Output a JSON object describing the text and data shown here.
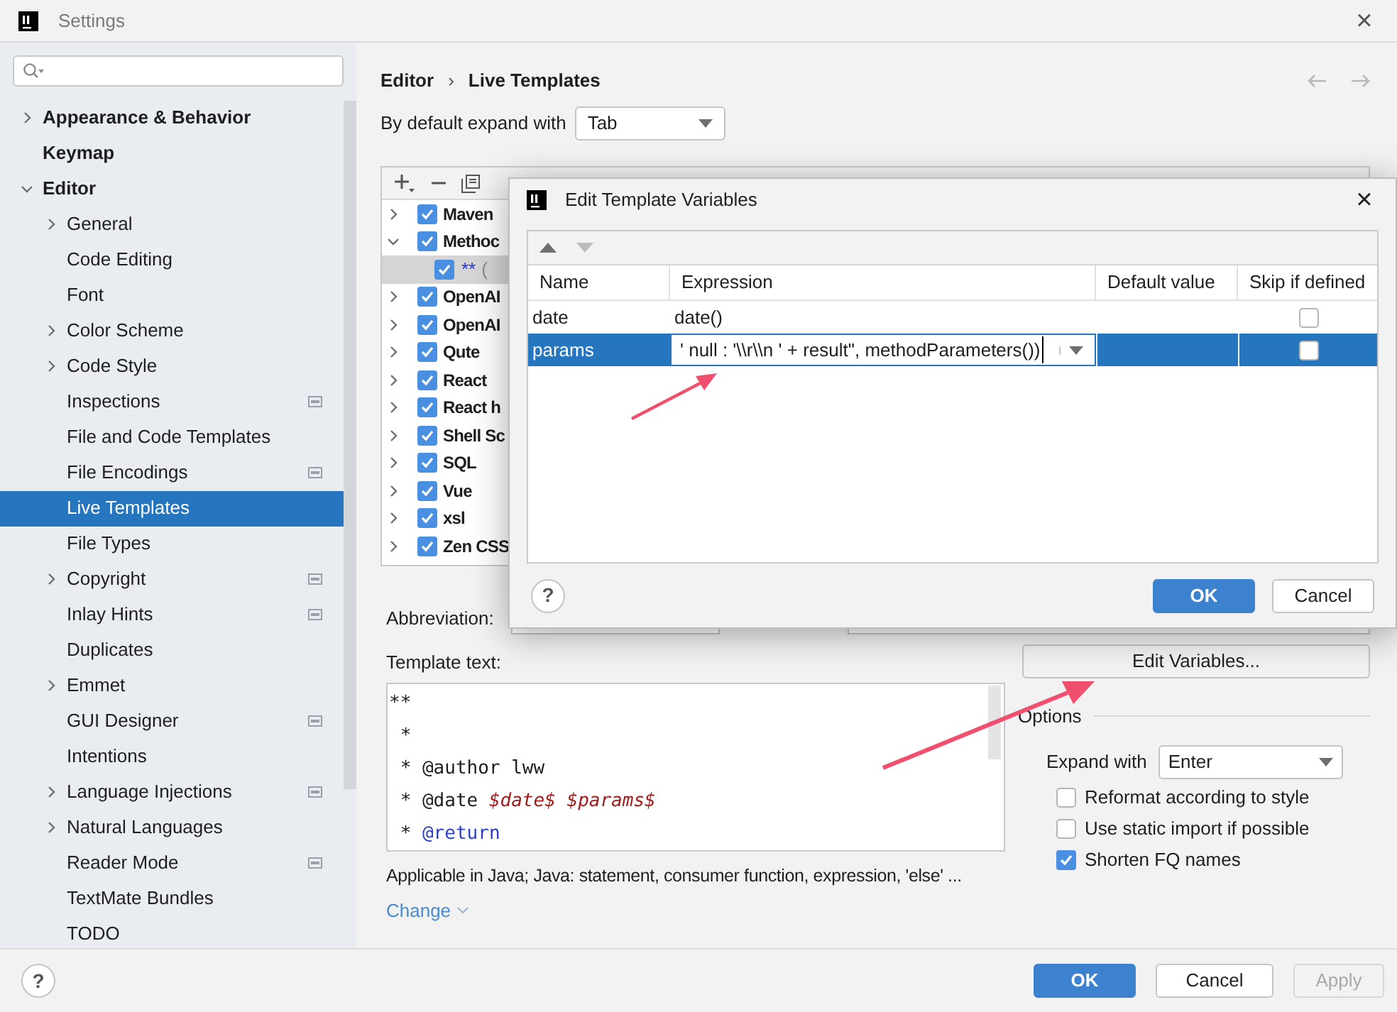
{
  "window": {
    "title": "Settings",
    "close": "×"
  },
  "sidebar": {
    "items": [
      {
        "label": "Appearance & Behavior",
        "expanded": false,
        "selected": false
      },
      {
        "label": "Keymap",
        "selected": false
      },
      {
        "label": "Editor",
        "expanded": true,
        "selected": false,
        "children": [
          {
            "label": "General",
            "expanded": false,
            "selected": false,
            "project_scoped": false
          },
          {
            "label": "Code Editing",
            "selected": false,
            "project_scoped": false
          },
          {
            "label": "Font",
            "selected": false,
            "project_scoped": false
          },
          {
            "label": "Color Scheme",
            "expanded": false,
            "selected": false,
            "project_scoped": false
          },
          {
            "label": "Code Style",
            "expanded": false,
            "selected": false,
            "project_scoped": false
          },
          {
            "label": "Inspections",
            "selected": false,
            "project_scoped": true
          },
          {
            "label": "File and Code Templates",
            "selected": false,
            "project_scoped": false
          },
          {
            "label": "File Encodings",
            "selected": false,
            "project_scoped": true
          },
          {
            "label": "Live Templates",
            "selected": true,
            "project_scoped": false
          },
          {
            "label": "File Types",
            "selected": false,
            "project_scoped": false
          },
          {
            "label": "Copyright",
            "expanded": false,
            "selected": false,
            "project_scoped": true
          },
          {
            "label": "Inlay Hints",
            "selected": false,
            "project_scoped": true
          },
          {
            "label": "Duplicates",
            "selected": false,
            "project_scoped": false
          },
          {
            "label": "Emmet",
            "expanded": false,
            "selected": false,
            "project_scoped": false
          },
          {
            "label": "GUI Designer",
            "selected": false,
            "project_scoped": true
          },
          {
            "label": "Intentions",
            "selected": false,
            "project_scoped": false
          },
          {
            "label": "Language Injections",
            "expanded": false,
            "selected": false,
            "project_scoped": true
          },
          {
            "label": "Natural Languages",
            "expanded": false,
            "selected": false,
            "project_scoped": false
          },
          {
            "label": "Reader Mode",
            "selected": false,
            "project_scoped": true
          },
          {
            "label": "TextMate Bundles",
            "selected": false,
            "project_scoped": false
          },
          {
            "label": "TODO",
            "selected": false,
            "project_scoped": false
          }
        ]
      }
    ]
  },
  "breadcrumb": [
    "Editor",
    "›",
    "Live Templates"
  ],
  "default_expand": {
    "label": "By default expand with",
    "value": "Tab"
  },
  "template_groups": [
    {
      "label": "Maven",
      "expanded": false,
      "checked": true
    },
    {
      "label": "Methoc",
      "expanded": true,
      "checked": true,
      "children": [
        {
          "abbreviation": "**",
          "description": "(",
          "checked": true,
          "selected": true
        }
      ]
    },
    {
      "label": "OpenAI",
      "expanded": false,
      "checked": true
    },
    {
      "label": "OpenAI",
      "expanded": false,
      "checked": true
    },
    {
      "label": "Qute",
      "expanded": false,
      "checked": true
    },
    {
      "label": "React",
      "expanded": false,
      "checked": true
    },
    {
      "label": "React h",
      "expanded": false,
      "checked": true
    },
    {
      "label": "Shell Sc",
      "expanded": false,
      "checked": true
    },
    {
      "label": "SQL",
      "expanded": false,
      "checked": true
    },
    {
      "label": "Vue",
      "expanded": false,
      "checked": true
    },
    {
      "label": "xsl",
      "expanded": false,
      "checked": true
    },
    {
      "label": "Zen CSS",
      "expanded": false,
      "checked": true
    }
  ],
  "abbreviation": {
    "label": "Abbreviation:"
  },
  "template_text": {
    "label": "Template text:",
    "lines": [
      [
        {
          "kind": "plain",
          "text": "**"
        }
      ],
      [
        {
          "kind": "plain",
          "text": " *"
        }
      ],
      [
        {
          "kind": "plain",
          "text": " * @author lww"
        }
      ],
      [
        {
          "kind": "plain",
          "text": " * @date "
        },
        {
          "kind": "variable",
          "text": "$date$"
        },
        {
          "kind": "variable",
          "text": " $params$"
        }
      ],
      [
        {
          "kind": "plain",
          "text": " * "
        },
        {
          "kind": "tag",
          "text": "@return"
        }
      ]
    ]
  },
  "applicable": "Applicable in Java; Java: statement, consumer function, expression, 'else' ...",
  "change_link": "Change",
  "edit_variables_button": "Edit Variables...",
  "options": {
    "title": "Options",
    "expand_with": {
      "label": "Expand with",
      "value": "Enter"
    },
    "checkboxes": [
      {
        "label": "Reformat according to style",
        "checked": false
      },
      {
        "label": "Use static import if possible",
        "checked": false
      },
      {
        "label": "Shorten FQ names",
        "checked": true
      }
    ]
  },
  "buttons": [
    {
      "label": "OK",
      "kind": "primary",
      "disabled": false
    },
    {
      "label": "Cancel",
      "kind": "secondary",
      "disabled": false
    },
    {
      "label": "Apply",
      "kind": "secondary",
      "disabled": true
    }
  ],
  "help": "?",
  "dialog": {
    "title": "Edit Template Variables",
    "close": "×",
    "columns": [
      "Name",
      "Expression",
      "Default value",
      "Skip if defined"
    ],
    "rows": [
      {
        "name": "date",
        "expression": "date()",
        "skip_if_defined": false,
        "selected": false,
        "editing": false
      },
      {
        "name": "params",
        "expression": "' null : '\\\\r\\\\n ' + result\", methodParameters())",
        "skip_if_defined": false,
        "selected": true,
        "editing": true
      }
    ],
    "help": "?",
    "buttons": [
      {
        "label": "OK",
        "kind": "primary"
      },
      {
        "label": "Cancel",
        "kind": "secondary"
      }
    ]
  }
}
